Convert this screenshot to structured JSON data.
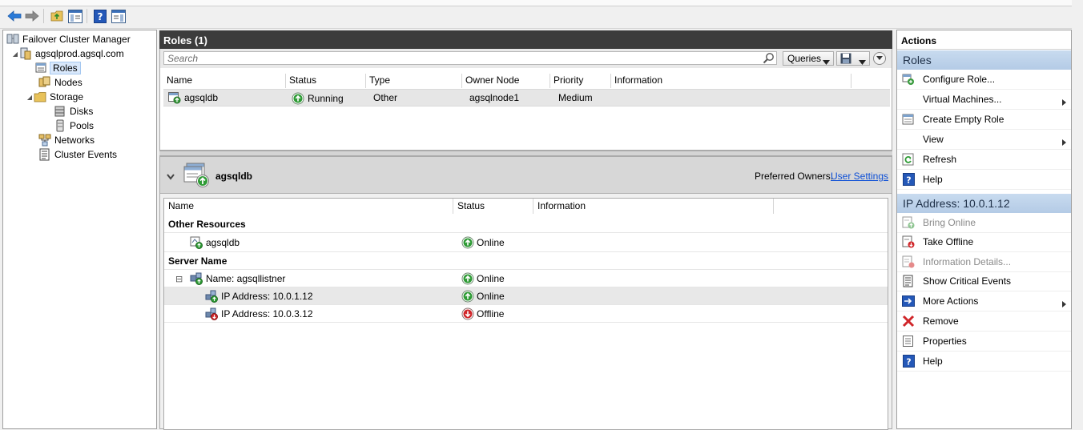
{
  "tree": {
    "items": [
      {
        "label": "Failover Cluster Manager",
        "icon": "cluster-manager-icon"
      },
      {
        "label": "agsqlprod.agsql.com",
        "icon": "cluster-icon",
        "expander": "◢"
      },
      {
        "label": "Roles",
        "icon": "roles-icon"
      },
      {
        "label": "Nodes",
        "icon": "nodes-icon"
      },
      {
        "label": "Storage",
        "icon": "storage-icon",
        "expander": "◢"
      },
      {
        "label": "Disks",
        "icon": "disks-icon"
      },
      {
        "label": "Pools",
        "icon": "pools-icon"
      },
      {
        "label": "Networks",
        "icon": "networks-icon"
      },
      {
        "label": "Cluster Events",
        "icon": "cluster-events-icon"
      }
    ]
  },
  "roles_panel": {
    "title": "Roles (1)",
    "search_placeholder": "Search",
    "queries_label": "Queries",
    "columns": [
      "Name",
      "Status",
      "Type",
      "Owner Node",
      "Priority",
      "Information"
    ],
    "rows": [
      {
        "name": "agsqldb",
        "status": "Running",
        "type": "Other",
        "owner_node": "agsqlnode1",
        "priority": "Medium",
        "information": ""
      }
    ]
  },
  "detail": {
    "title": "agsqldb",
    "preferred_owners_label": "Preferred Owners:",
    "user_settings_link": "User Settings",
    "columns": [
      "Name",
      "Status",
      "Information"
    ],
    "groups": {
      "other_resources": "Other Resources",
      "server_name": "Server Name"
    },
    "rows": [
      {
        "name": "agsqldb",
        "status": "Online",
        "status_kind": "up"
      },
      {
        "name": "Name: agsqllistner",
        "status": "Online",
        "status_kind": "up",
        "expander": "⊟"
      },
      {
        "name": "IP Address: 10.0.1.12",
        "status": "Online",
        "status_kind": "up"
      },
      {
        "name": "IP Address: 10.0.3.12",
        "status": "Offline",
        "status_kind": "down"
      }
    ]
  },
  "actions": {
    "title": "Actions",
    "roles_section": "Roles",
    "roles_items": [
      {
        "label": "Configure Role...",
        "icon": "configure-role-icon",
        "enabled": true
      },
      {
        "label": "Virtual Machines...",
        "icon": "",
        "enabled": true
      },
      {
        "label": "Create Empty Role",
        "icon": "create-empty-role-icon",
        "enabled": true
      },
      {
        "label": "View",
        "icon": "",
        "enabled": true
      },
      {
        "label": "Refresh",
        "icon": "refresh-icon",
        "enabled": true
      },
      {
        "label": "Help",
        "icon": "help-icon",
        "enabled": true
      }
    ],
    "ip_section": "IP Address: 10.0.1.12",
    "ip_items": [
      {
        "label": "Bring Online",
        "icon": "bring-online-icon",
        "enabled": false
      },
      {
        "label": "Take Offline",
        "icon": "take-offline-icon",
        "enabled": true
      },
      {
        "label": "Information Details...",
        "icon": "information-details-icon",
        "enabled": false
      },
      {
        "label": "Show Critical Events",
        "icon": "critical-events-icon",
        "enabled": true
      },
      {
        "label": "More Actions",
        "icon": "more-actions-icon",
        "enabled": true
      },
      {
        "label": "Remove",
        "icon": "remove-icon",
        "enabled": true
      },
      {
        "label": "Properties",
        "icon": "properties-icon",
        "enabled": true
      },
      {
        "label": "Help",
        "icon": "help-icon",
        "enabled": true
      }
    ]
  },
  "colors": {
    "online_green": "#2e9b35",
    "offline_red": "#d0262a",
    "section_blue": "#c0d5ee",
    "link_blue": "#0d4fd6",
    "header_dark": "#3c3c3c"
  }
}
